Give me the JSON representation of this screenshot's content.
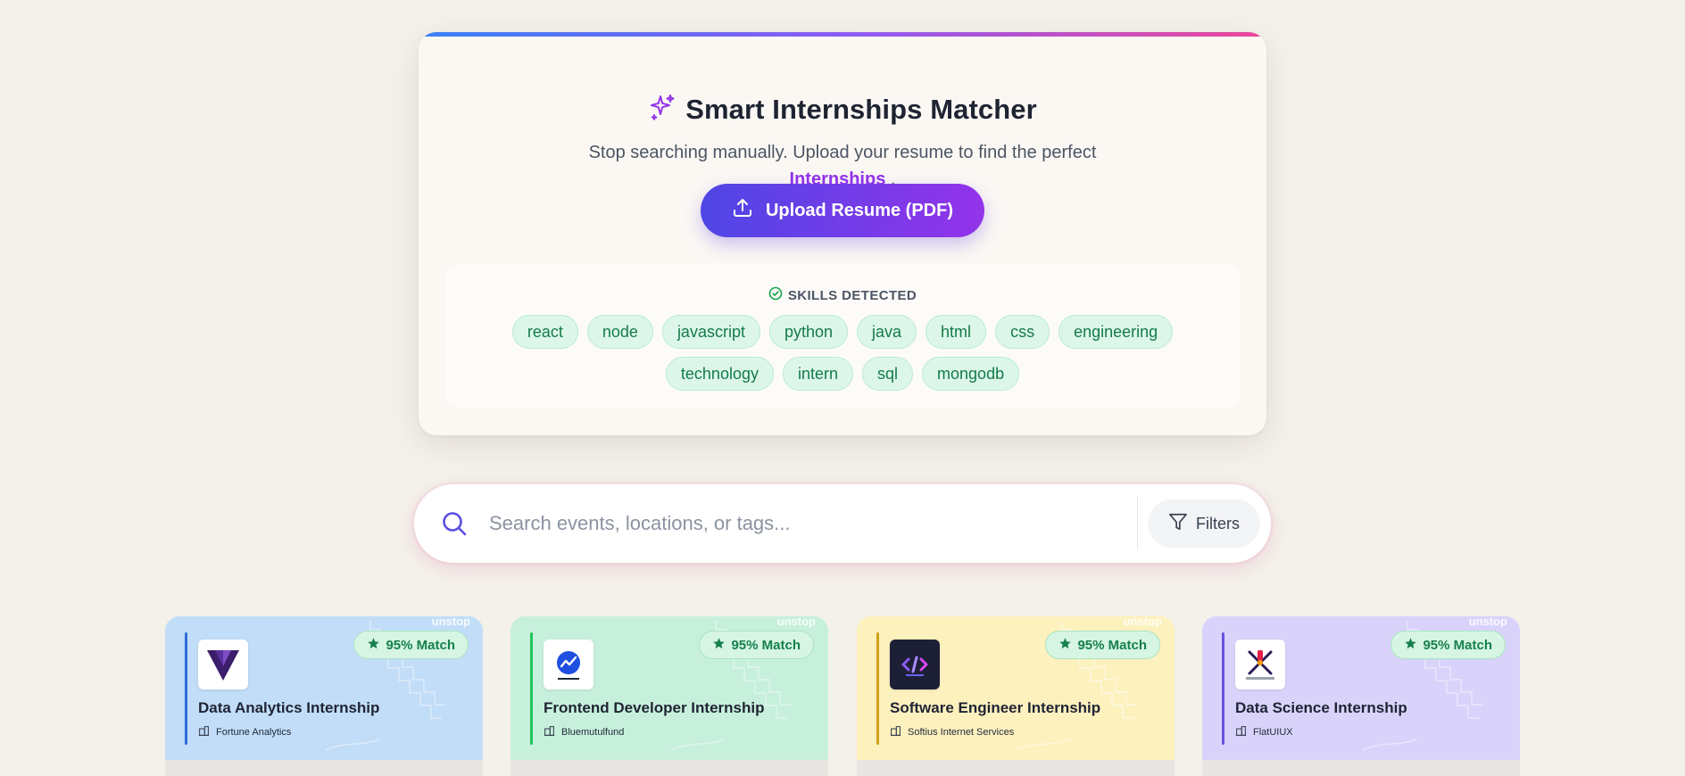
{
  "hero": {
    "title": "Smart Internships Matcher",
    "subtitle_line1": "Stop searching manually. Upload your resume to find the perfect",
    "subtitle_highlight": "Internships",
    "subtitle_end": " .",
    "upload_button_label": "Upload Resume (PDF)",
    "icon": "sparkles-icon"
  },
  "skills": {
    "heading": "SKILLS DETECTED",
    "row1": [
      "react",
      "node",
      "javascript",
      "python",
      "java",
      "html",
      "css",
      "engineering"
    ],
    "row2": [
      "technology",
      "intern",
      "sql",
      "mongodb"
    ]
  },
  "search": {
    "placeholder": "Search events, locations, or tags...",
    "value": "",
    "filters_label": "Filters"
  },
  "cards": [
    {
      "title": "Data Analytics Internship",
      "company": "Fortune Analytics",
      "match": "95% Match",
      "watermark": "unstop",
      "bg": "#c2ddf8",
      "bar": "#2b6cd9"
    },
    {
      "title": "Frontend Developer Internship",
      "company": "Bluemutulfund",
      "match": "95% Match",
      "watermark": "unstop",
      "bg": "#c7f0dc",
      "bar": "#22c55e"
    },
    {
      "title": "Software Engineer Internship",
      "company": "Softius Internet Services",
      "match": "95% Match",
      "watermark": "unstop",
      "bg": "#fdf1be",
      "bar": "#d4a017"
    },
    {
      "title": "Data Science Internship",
      "company": "FlatUIUX",
      "match": "95% Match",
      "watermark": "unstop",
      "bg": "#d9d3fb",
      "bar": "#6d4fe0"
    }
  ],
  "colors": {
    "page_bg": "#f4f1ea",
    "accent_purple": "#9333ea",
    "accent_indigo": "#4f46e5",
    "skill_green": "#157a4a"
  }
}
